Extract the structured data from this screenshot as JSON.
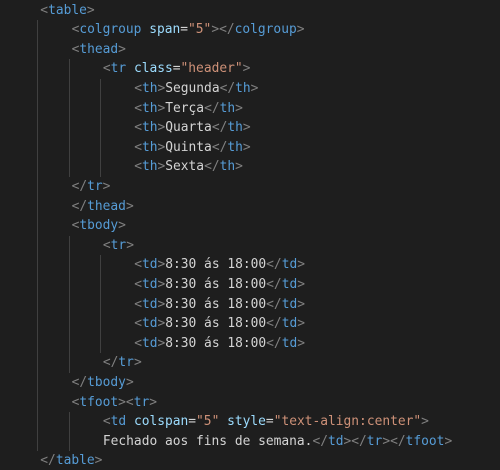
{
  "editor": {
    "theme": "dark",
    "colors": {
      "background": "#1e1e1e",
      "tag": "#569cd6",
      "bracket": "#808080",
      "attribute": "#9cdcfe",
      "string": "#ce9178",
      "text": "#d4d4d4",
      "indent_guide": "#404040"
    },
    "lines": [
      {
        "indent": 1,
        "tokens": [
          [
            "b",
            "<"
          ],
          [
            "t",
            "table"
          ],
          [
            "b",
            ">"
          ]
        ]
      },
      {
        "indent": 2,
        "tokens": [
          [
            "b",
            "<"
          ],
          [
            "t",
            "colgroup"
          ],
          [
            "s",
            " "
          ],
          [
            "a",
            "span"
          ],
          [
            "s",
            "="
          ],
          [
            "v",
            "\"5\""
          ],
          [
            "b",
            ">"
          ],
          [
            "b",
            "</"
          ],
          [
            "t",
            "colgroup"
          ],
          [
            "b",
            ">"
          ]
        ]
      },
      {
        "indent": 2,
        "tokens": [
          [
            "b",
            "<"
          ],
          [
            "t",
            "thead"
          ],
          [
            "b",
            ">"
          ]
        ]
      },
      {
        "indent": 3,
        "tokens": [
          [
            "b",
            "<"
          ],
          [
            "t",
            "tr"
          ],
          [
            "s",
            " "
          ],
          [
            "a",
            "class"
          ],
          [
            "s",
            "="
          ],
          [
            "v",
            "\"header\""
          ],
          [
            "b",
            ">"
          ]
        ]
      },
      {
        "indent": 4,
        "tokens": [
          [
            "b",
            "<"
          ],
          [
            "t",
            "th"
          ],
          [
            "b",
            ">"
          ],
          [
            "x",
            "Segunda"
          ],
          [
            "b",
            "</"
          ],
          [
            "t",
            "th"
          ],
          [
            "b",
            ">"
          ]
        ]
      },
      {
        "indent": 4,
        "tokens": [
          [
            "b",
            "<"
          ],
          [
            "t",
            "th"
          ],
          [
            "b",
            ">"
          ],
          [
            "x",
            "Terça"
          ],
          [
            "b",
            "</"
          ],
          [
            "t",
            "th"
          ],
          [
            "b",
            ">"
          ]
        ]
      },
      {
        "indent": 4,
        "tokens": [
          [
            "b",
            "<"
          ],
          [
            "t",
            "th"
          ],
          [
            "b",
            ">"
          ],
          [
            "x",
            "Quarta"
          ],
          [
            "b",
            "</"
          ],
          [
            "t",
            "th"
          ],
          [
            "b",
            ">"
          ]
        ]
      },
      {
        "indent": 4,
        "tokens": [
          [
            "b",
            "<"
          ],
          [
            "t",
            "th"
          ],
          [
            "b",
            ">"
          ],
          [
            "x",
            "Quinta"
          ],
          [
            "b",
            "</"
          ],
          [
            "t",
            "th"
          ],
          [
            "b",
            ">"
          ]
        ]
      },
      {
        "indent": 4,
        "tokens": [
          [
            "b",
            "<"
          ],
          [
            "t",
            "th"
          ],
          [
            "b",
            ">"
          ],
          [
            "x",
            "Sexta"
          ],
          [
            "b",
            "</"
          ],
          [
            "t",
            "th"
          ],
          [
            "b",
            ">"
          ]
        ]
      },
      {
        "indent": 2,
        "tokens": [
          [
            "b",
            "</"
          ],
          [
            "t",
            "tr"
          ],
          [
            "b",
            ">"
          ]
        ]
      },
      {
        "indent": 2,
        "tokens": [
          [
            "b",
            "</"
          ],
          [
            "t",
            "thead"
          ],
          [
            "b",
            ">"
          ]
        ]
      },
      {
        "indent": 2,
        "tokens": [
          [
            "b",
            "<"
          ],
          [
            "t",
            "tbody"
          ],
          [
            "b",
            ">"
          ]
        ]
      },
      {
        "indent": 3,
        "tokens": [
          [
            "b",
            "<"
          ],
          [
            "t",
            "tr"
          ],
          [
            "b",
            ">"
          ]
        ]
      },
      {
        "indent": 4,
        "tokens": [
          [
            "b",
            "<"
          ],
          [
            "t",
            "td"
          ],
          [
            "b",
            ">"
          ],
          [
            "x",
            "8:30 ás 18:00"
          ],
          [
            "b",
            "</"
          ],
          [
            "t",
            "td"
          ],
          [
            "b",
            ">"
          ]
        ]
      },
      {
        "indent": 4,
        "tokens": [
          [
            "b",
            "<"
          ],
          [
            "t",
            "td"
          ],
          [
            "b",
            ">"
          ],
          [
            "x",
            "8:30 ás 18:00"
          ],
          [
            "b",
            "</"
          ],
          [
            "t",
            "td"
          ],
          [
            "b",
            ">"
          ]
        ]
      },
      {
        "indent": 4,
        "tokens": [
          [
            "b",
            "<"
          ],
          [
            "t",
            "td"
          ],
          [
            "b",
            ">"
          ],
          [
            "x",
            "8:30 ás 18:00"
          ],
          [
            "b",
            "</"
          ],
          [
            "t",
            "td"
          ],
          [
            "b",
            ">"
          ]
        ]
      },
      {
        "indent": 4,
        "tokens": [
          [
            "b",
            "<"
          ],
          [
            "t",
            "td"
          ],
          [
            "b",
            ">"
          ],
          [
            "x",
            "8:30 ás 18:00"
          ],
          [
            "b",
            "</"
          ],
          [
            "t",
            "td"
          ],
          [
            "b",
            ">"
          ]
        ]
      },
      {
        "indent": 4,
        "tokens": [
          [
            "b",
            "<"
          ],
          [
            "t",
            "td"
          ],
          [
            "b",
            ">"
          ],
          [
            "x",
            "8:30 ás 18:00"
          ],
          [
            "b",
            "</"
          ],
          [
            "t",
            "td"
          ],
          [
            "b",
            ">"
          ]
        ]
      },
      {
        "indent": 3,
        "tokens": [
          [
            "b",
            "</"
          ],
          [
            "t",
            "tr"
          ],
          [
            "b",
            ">"
          ]
        ]
      },
      {
        "indent": 2,
        "tokens": [
          [
            "b",
            "</"
          ],
          [
            "t",
            "tbody"
          ],
          [
            "b",
            ">"
          ]
        ]
      },
      {
        "indent": 2,
        "tokens": [
          [
            "b",
            "<"
          ],
          [
            "t",
            "tfoot"
          ],
          [
            "b",
            "><"
          ],
          [
            "t",
            "tr"
          ],
          [
            "b",
            ">"
          ]
        ]
      },
      {
        "indent": 3,
        "tokens": [
          [
            "b",
            "<"
          ],
          [
            "t",
            "td"
          ],
          [
            "s",
            " "
          ],
          [
            "a",
            "colspan"
          ],
          [
            "s",
            "="
          ],
          [
            "v",
            "\"5\""
          ],
          [
            "s",
            " "
          ],
          [
            "a",
            "style"
          ],
          [
            "s",
            "="
          ],
          [
            "v",
            "\"text-align:center\""
          ],
          [
            "b",
            ">"
          ]
        ]
      },
      {
        "indent": 3,
        "tokens": [
          [
            "x",
            "Fechado aos fins de semana."
          ],
          [
            "b",
            "</"
          ],
          [
            "t",
            "td"
          ],
          [
            "b",
            "></"
          ],
          [
            "t",
            "tr"
          ],
          [
            "b",
            "></"
          ],
          [
            "t",
            "tfoot"
          ],
          [
            "b",
            ">"
          ]
        ]
      },
      {
        "indent": 1,
        "tokens": [
          [
            "b",
            "</"
          ],
          [
            "t",
            "table"
          ],
          [
            "b",
            ">"
          ]
        ]
      }
    ]
  }
}
